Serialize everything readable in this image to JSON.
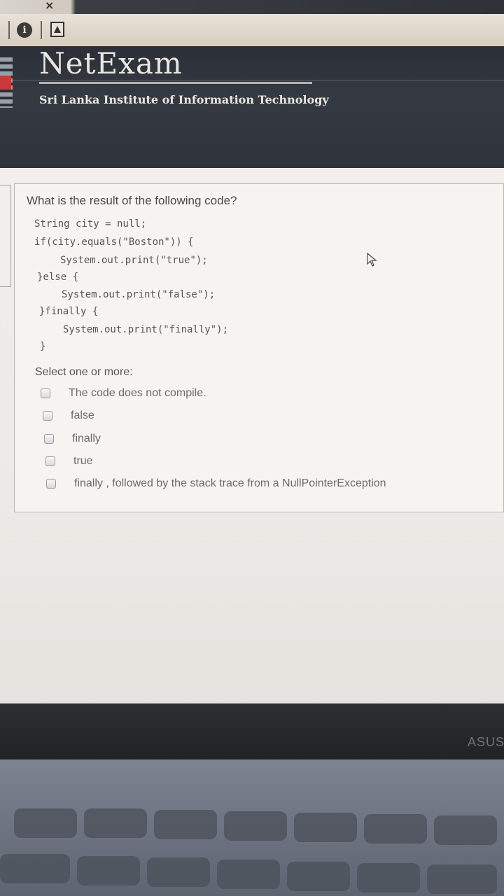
{
  "browser": {
    "close_glyph": "×"
  },
  "header": {
    "title": "NetExam",
    "subtitle": "Sri Lanka Institute of Information Technology"
  },
  "question": {
    "prompt": "What is the result of the following code?",
    "code_lines": [
      "String city = null;",
      "if(city.equals(\"Boston\")) {",
      "System.out.print(\"true\");",
      "}else {",
      "System.out.print(\"false\");",
      "}finally {",
      "System.out.print(\"finally\");",
      "}"
    ],
    "select_label": "Select one or more:",
    "options": [
      {
        "label": "The code does not compile.",
        "checked": false
      },
      {
        "label": "false",
        "checked": false
      },
      {
        "label": "finally",
        "checked": false
      },
      {
        "label": "true",
        "checked": false
      },
      {
        "label": "finally , followed by the stack trace from a NullPointerException",
        "checked": false
      }
    ]
  },
  "device": {
    "brand": "ASUS"
  },
  "colors": {
    "header_bg": "#2f343b",
    "page_bg": "#f1eeeb"
  }
}
